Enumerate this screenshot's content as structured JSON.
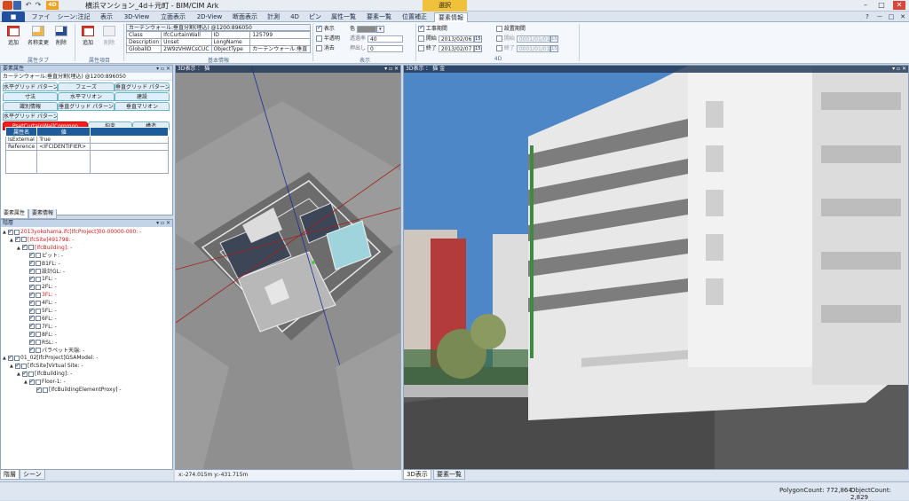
{
  "titlebar": {
    "title": "横浜マンション_4d＋元町 - BIM/CIM Ark",
    "badge": "4D",
    "context_tab": "選択",
    "controls": [
      "–",
      "□",
      "✕"
    ]
  },
  "menu": {
    "file_button": "■",
    "tabs": [
      "ファイル",
      "シーン:注記",
      "表示",
      "3D-View",
      "立面表示",
      "2D-View",
      "断面表示",
      "計測",
      "4D",
      "ピン",
      "属性一覧",
      "要素一覧",
      "位置補正",
      "要素情報"
    ],
    "active_tab": "要素情報",
    "right_controls": [
      "?",
      "－",
      "□",
      "✕"
    ]
  },
  "ribbon": {
    "attr_tab_group": {
      "label": "属性タブ",
      "buttons": [
        "追加",
        "名称変更",
        "削除"
      ]
    },
    "attr_item_group": {
      "label": "属性項目",
      "buttons": [
        "追加",
        "削除"
      ]
    },
    "basic_info": {
      "label": "基本情報",
      "header": "カーテンウォール:垂直分割(埋込) @1200:896050",
      "rows": [
        [
          "Class",
          "IfcCurtainWall",
          "ID",
          "125799"
        ],
        [
          "Description",
          "Unset",
          "LongName",
          ""
        ],
        [
          "GlobalID",
          "2W9zVHWCsCUC",
          "ObjectType",
          "カーテンウォール:垂直"
        ]
      ]
    },
    "display": {
      "label": "表示",
      "show": "表示",
      "color_label": "色",
      "semi_transparent": "半透明",
      "transparency_label": "透過率",
      "transparency_value": "40",
      "erase": "消去",
      "extrude_label": "押出し",
      "extrude_value": "0"
    },
    "period4d": {
      "label": "4D",
      "construction_period": "工事期間",
      "start": "開始",
      "start_date": "2013/02/06",
      "end": "終了",
      "end_date": "2013/02/07",
      "install_period": "設置期間",
      "install_start": "開始",
      "install_start_date": "0001/01/01",
      "install_end": "終了",
      "install_end_date": "0001/01/01",
      "cal": "15"
    }
  },
  "element_attr_panel": {
    "title": "要素属性",
    "object_name": "カーテンウォール:垂直分割(埋込) @1200:896050",
    "psets": [
      "水平グリッド パターン",
      "フェーズ",
      "垂直グリッド パターン",
      "寸法",
      "水平マリオン",
      "建設",
      "識別情報",
      "垂直グリッド パターン",
      "垂直マリオン",
      "水平グリッド パターン",
      "PsetCurtainWallCommon",
      "拘束",
      "構造"
    ],
    "selected_pset": "PsetCurtainWallCommon",
    "table_headers": [
      "属性名",
      "値"
    ],
    "rows": [
      [
        "IsExternal",
        "True"
      ],
      [
        "Reference",
        "<IFCIDENTIFIER>"
      ]
    ],
    "bottom_tabs": [
      "要素属性",
      "要素情報"
    ]
  },
  "tree_panel": {
    "title": "階層",
    "nodes": [
      {
        "indent": 0,
        "toggle": "▲",
        "label": "2013yokohama.ifc[IfcProject]00-00000-000:",
        "red": true
      },
      {
        "indent": 1,
        "toggle": "▲",
        "label": "[IfcSite]491798:",
        "red": true
      },
      {
        "indent": 2,
        "toggle": "▲",
        "label": "[IfcBuilding]:",
        "red": true
      },
      {
        "indent": 3,
        "toggle": "",
        "label": "ピット:",
        "red": false
      },
      {
        "indent": 3,
        "toggle": "",
        "label": "B1FL:",
        "red": false
      },
      {
        "indent": 3,
        "toggle": "",
        "label": "設計GL:",
        "red": false
      },
      {
        "indent": 3,
        "toggle": "",
        "label": "1FL:",
        "red": false
      },
      {
        "indent": 3,
        "toggle": "",
        "label": "2FL:",
        "red": false
      },
      {
        "indent": 3,
        "toggle": "",
        "label": "3FL:",
        "red": true
      },
      {
        "indent": 3,
        "toggle": "",
        "label": "4FL:",
        "red": false
      },
      {
        "indent": 3,
        "toggle": "",
        "label": "5FL:",
        "red": false
      },
      {
        "indent": 3,
        "toggle": "",
        "label": "6FL:",
        "red": false
      },
      {
        "indent": 3,
        "toggle": "",
        "label": "7FL:",
        "red": false
      },
      {
        "indent": 3,
        "toggle": "",
        "label": "8FL:",
        "red": false
      },
      {
        "indent": 3,
        "toggle": "",
        "label": "RSL:",
        "red": false
      },
      {
        "indent": 3,
        "toggle": "",
        "label": "パラペット天端:",
        "red": false
      },
      {
        "indent": 0,
        "toggle": "▲",
        "label": "01_02[IfcProject]GSAModel:",
        "red": false
      },
      {
        "indent": 1,
        "toggle": "▲",
        "label": "[IfcSite]Virtual Site:",
        "red": false
      },
      {
        "indent": 2,
        "toggle": "▲",
        "label": "[IfcBuilding]:",
        "red": false
      },
      {
        "indent": 3,
        "toggle": "▲",
        "label": "Floor-1:",
        "red": false
      },
      {
        "indent": 4,
        "toggle": "",
        "label": "[IfcBuildingElementProxy]",
        "red": false
      }
    ],
    "suffix": " -",
    "bottom_tabs": [
      "階層",
      "シーン"
    ]
  },
  "view_top": {
    "title": "3D表示 ：  猫",
    "coords": "x:-274.015m y:-431.715m"
  },
  "view_main": {
    "title": "3D表示 ：  猫  金",
    "bottom_tabs": [
      "3D表示",
      "要素一覧"
    ]
  },
  "status": {
    "polygon": "PolygonCount: 772,864",
    "object": "ObjectCount: 2,829"
  }
}
